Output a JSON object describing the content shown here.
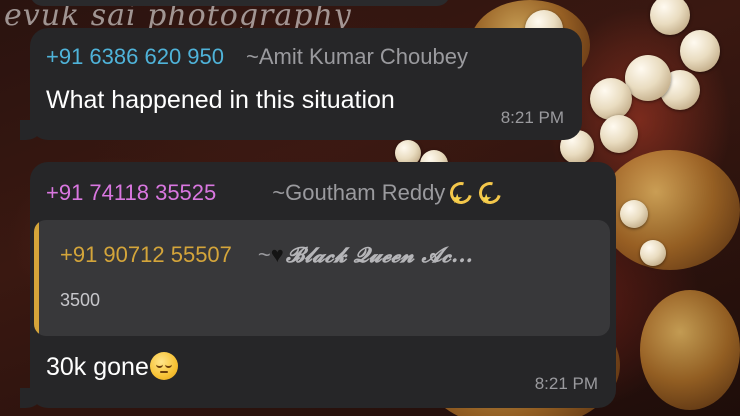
{
  "wallpaper": {
    "watermark_text": "evuk sai photography"
  },
  "messages": [
    {
      "sender_phone": "+91 6386 620 950",
      "sender_name": "~Amit Kumar Choubey",
      "sender_color": "#4fb3d9",
      "text": "What happened in this situation",
      "time": "8:21 PM"
    },
    {
      "sender_phone": "+91 74118 35525",
      "sender_name": "~Goutham Reddy",
      "sender_emojis": [
        "dizzy-icon",
        "dizzy-icon"
      ],
      "sender_color": "#d977e0",
      "quote": {
        "phone": "+91 90712 55507",
        "name_prefix": "~",
        "name_emoji": "black-heart-icon",
        "name": "𝓑𝓵𝓪𝓬𝓴 𝓠𝓾𝓮𝓮𝓷 𝓐𝓬...",
        "text": "3500",
        "color": "#d4a53a"
      },
      "text": "30k gone",
      "text_emoji": "pensive-face-icon",
      "time": "8:21 PM"
    }
  ]
}
